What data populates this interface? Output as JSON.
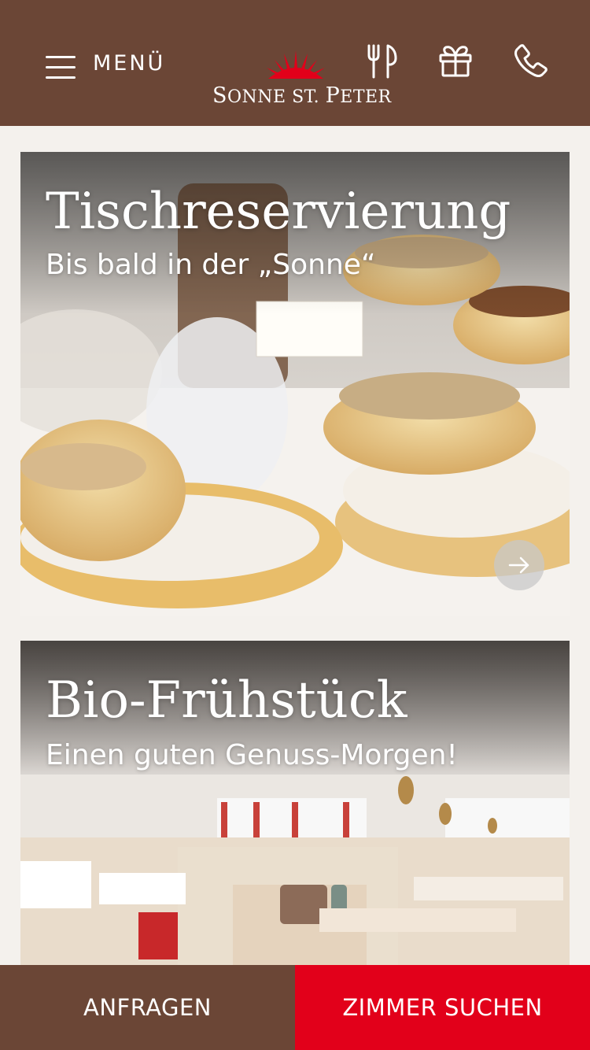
{
  "header": {
    "menu_label": "MENÜ",
    "logo_text_prefix": "S",
    "logo_text": "ONNE ",
    "logo_text_2": "ST. ",
    "logo_text_3": "P",
    "logo_text_4": "ETER",
    "icons": [
      "cutlery-icon",
      "gift-icon",
      "phone-icon"
    ],
    "colors": {
      "background": "#6b4636",
      "logo_sun": "#e2001a"
    }
  },
  "cards": [
    {
      "title": "Tischreservierung",
      "subtitle": "Bis bald in der „Sonne“"
    },
    {
      "title": "Bio-Frühstück",
      "subtitle": "Einen guten Genuss-Morgen!"
    }
  ],
  "bottom_bar": {
    "inquire_label": "ANFRAGEN",
    "rooms_label": "ZIMMER SUCHEN",
    "colors": {
      "inquire": "#6b4636",
      "rooms": "#e2001a"
    }
  }
}
